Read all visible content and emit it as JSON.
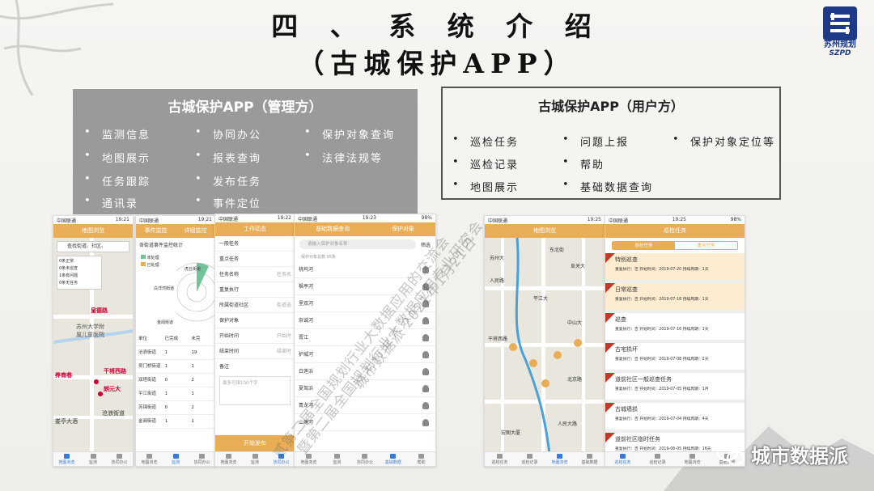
{
  "title": {
    "line1": "四 、 系 统 介 绍",
    "line2": "（古城保护APP）"
  },
  "logo": {
    "name": "苏州规划",
    "abbr": "SZPD"
  },
  "manager_box": {
    "heading": "古城保护APP（管理方）",
    "features": [
      "监测信息",
      "协同办公",
      "保护对象查询",
      "地图展示",
      "报表查询",
      "法律法规等",
      "任务跟踪",
      "发布任务",
      "通讯录",
      "事件定位"
    ]
  },
  "user_box": {
    "heading": "古城保护APP（用户方）",
    "features": [
      "巡检任务",
      "问题上报",
      "保护对象定位等",
      "巡检记录",
      "帮助",
      "地图展示",
      "基础数据查询"
    ]
  },
  "phone_common": {
    "carrier": "中国联通",
    "battery": "98%"
  },
  "phone1": {
    "time": "19:21",
    "nav": "地图浏览",
    "search": "查找街道、社区、",
    "legend": [
      "0条正常",
      "0条未巡查",
      "1条有问题",
      "0条无任务"
    ],
    "labels": [
      "苏州大学附",
      "属儿童医院",
      "皇德路",
      "养育巷",
      "干将西路",
      "朗元大",
      "沧浪街道",
      "娄亭大酒"
    ],
    "tabs": [
      "地图浏览",
      "监测",
      "协同办公"
    ]
  },
  "phone2": {
    "time": "19:21",
    "nav_left": "事件监控",
    "nav_right": "详细监控",
    "heading": "各街道事件监控统计",
    "legend": [
      "未处理",
      "已处理"
    ],
    "chart_labels": [
      "虎丘街道",
      "白洋湾街道",
      "金阊街道"
    ],
    "table_header": [
      "单位",
      "已完成",
      "未完"
    ],
    "rows": [
      [
        "沧浪街道",
        "1",
        "19"
      ],
      [
        "吴门桥街道",
        "1",
        "1"
      ],
      [
        "双塔街道",
        "0",
        "2"
      ],
      [
        "平江街道",
        "1",
        "1"
      ],
      [
        "苏锦街道",
        "0",
        "2"
      ],
      [
        "金阊街道",
        "1",
        "1"
      ]
    ],
    "tabs": [
      "地图浏览",
      "监测",
      "协同办公"
    ]
  },
  "phone3": {
    "time": "19:22",
    "nav": "工作动态",
    "rows": [
      "一般任务",
      "重点任务",
      "任务名称",
      "重复执行",
      "所属街道社区",
      "保护对象",
      "开始时间",
      "结束时间",
      "备注"
    ],
    "hints": [
      "任务名",
      "街道选",
      "开始时",
      "结束时"
    ],
    "note_placeholder": "最多可填100个字",
    "submit": "开始发布",
    "tabs": [
      "地图浏览",
      "监测",
      "协同办公"
    ]
  },
  "phone4": {
    "time": "19:23",
    "nav_left": "基础数据查询",
    "nav_right": "保护对象",
    "search": "请输入保护对象名称",
    "filter": "筛选",
    "count": "保护对象总数 95条",
    "items": [
      "桃坞河",
      "枫亭河",
      "里双河",
      "奈诚河",
      "胥江",
      "护城河",
      "白莲浜",
      "夏驾浜",
      "青龙河",
      "山塘河"
    ],
    "tabs": [
      "地图浏览",
      "监测",
      "协同办公",
      "基础数据",
      "帮助"
    ]
  },
  "phone5": {
    "time": "19:25",
    "nav": "地图浏览",
    "labels": [
      "苏州大",
      "人民路",
      "平江大",
      "东北街",
      "阜关大",
      "中山大",
      "北京路",
      "干将西路",
      "人民大路",
      "宏图大厦"
    ],
    "tabs": [
      "巡检任务",
      "巡检记录",
      "地图浏览",
      "基础数据"
    ]
  },
  "phone6": {
    "time": "19:25",
    "nav": "巡检任务",
    "seg": [
      "巡检任务",
      "重点任务"
    ],
    "tasks": [
      {
        "title": "特别巡查",
        "meta": "重复执行：否  开始时间：2019-07-20  持续周期：1天"
      },
      {
        "title": "日常巡查",
        "meta": "重复执行：否  开始时间：2019-07-18  持续周期：1天"
      },
      {
        "title": "巡查",
        "meta": "重复执行：否  开始时间：2019-07-16  持续周期：1天"
      },
      {
        "title": "古宅损坏",
        "meta": "重复执行：否  开始时间：2019-07-08  持续周期：2天"
      },
      {
        "title": "道前社区一般巡查任务",
        "meta": "重复执行：否  开始时间：2019-07-05  持续周期：1月"
      },
      {
        "title": "古城墙损",
        "meta": "重复执行：否  开始时间：2019-07-04  持续周期：4天"
      },
      {
        "title": "道前社区临时任务",
        "meta": "重复执行：否  开始时间：2019-06-05  持续周期：16天"
      }
    ],
    "tabs": [
      "巡检任务",
      "巡检记录",
      "地图浏览",
      "基础数据"
    ]
  },
  "watermarks": [
    "贰第二届全国规划行业大数据应用的交流会",
    "暨第二届全国规划行业大数据应用专业研究会",
    "城市数据派 2021年1月21日"
  ],
  "wechat": "城市数据派",
  "colors": {
    "accent": "#e8ad55",
    "manager_box": "#9a9a9a",
    "logo": "#1c3a88"
  }
}
